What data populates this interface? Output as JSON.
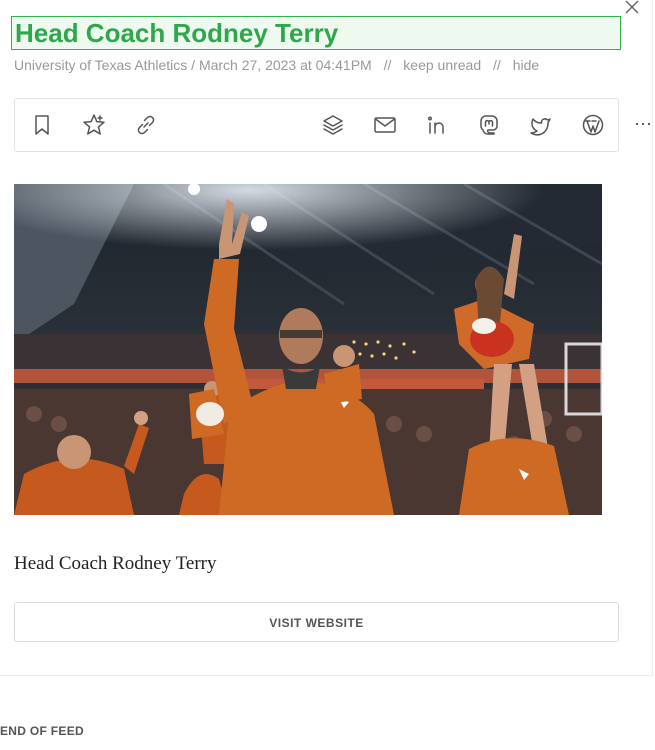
{
  "article": {
    "title": "Head Coach Rodney Terry",
    "source": "University of Texas Athletics",
    "date_separator": " / ",
    "date": "March 27, 2023 at 04:41PM",
    "actions_separator": "//",
    "keep_unread_label": "keep unread",
    "hide_label": "hide",
    "caption": "Head Coach Rodney Terry",
    "visit_label": "VISIT WEBSITE"
  },
  "toolbar": {
    "icons": [
      "bookmark-icon",
      "star-icon",
      "link-icon",
      "layers-icon",
      "email-icon",
      "linkedin-icon",
      "mastodon-icon",
      "twitter-icon",
      "wordpress-icon"
    ],
    "more_label": "⋯"
  },
  "footer": {
    "end_label": "END OF FEED"
  },
  "colors": {
    "title_green": "#2fa84a",
    "title_bg": "#eef9f0",
    "burnt_orange": "#cc5500",
    "meta_gray": "#999999"
  }
}
